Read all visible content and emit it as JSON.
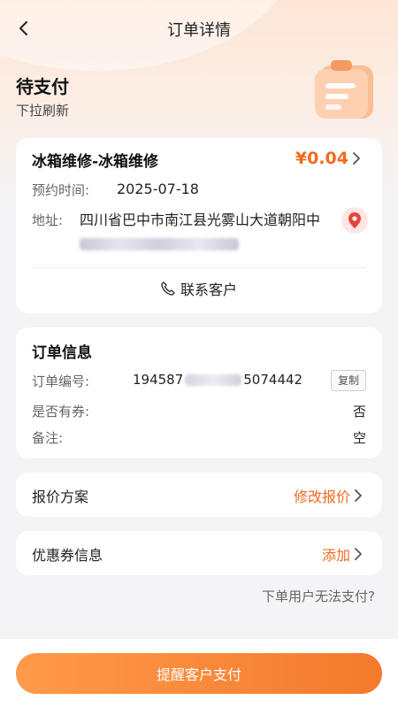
{
  "nav": {
    "title": "订单详情"
  },
  "status": {
    "title": "待支付",
    "subtitle": "下拉刷新"
  },
  "service": {
    "title": "冰箱维修-冰箱维修",
    "price": "¥0.04",
    "appointment_label": "预约时间:",
    "appointment_value": "2025-07-18",
    "address_label": "地址:",
    "address_value": "四川省巴中市南江县光雾山大道朝阳中",
    "contact_label": "联系客户"
  },
  "order_info": {
    "title": "订单信息",
    "number_label": "订单编号:",
    "number_prefix": "194587",
    "number_suffix": "5074442",
    "copy_label": "复制",
    "coupon_label": "是否有券:",
    "coupon_value": "否",
    "remark_label": "备注:",
    "remark_value": "空"
  },
  "quote": {
    "label": "报价方案",
    "action": "修改报价"
  },
  "coupon": {
    "label": "优惠券信息",
    "action": "添加"
  },
  "help_link": "下单用户无法支付?",
  "pay_button": "提醒客户支付",
  "colors": {
    "accent": "#f16a1d",
    "button_start": "#ff9a4a",
    "button_end": "#f47a2c"
  }
}
